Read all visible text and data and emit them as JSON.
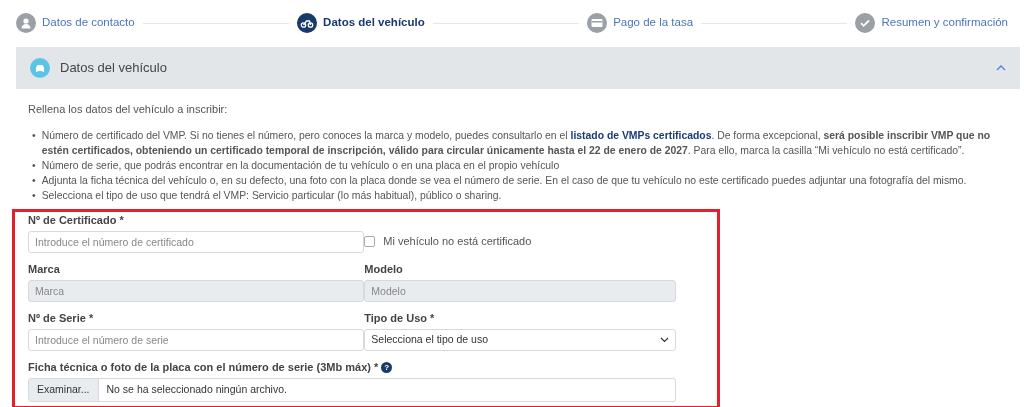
{
  "steps": [
    {
      "label": "Datos de contacto",
      "selected": false
    },
    {
      "label": "Datos del vehículo",
      "selected": true
    },
    {
      "label": "Pago de la tasa",
      "selected": false
    },
    {
      "label": "Resumen y confirmación",
      "selected": false
    }
  ],
  "section": {
    "title": "Datos del vehículo",
    "expanded": true
  },
  "intro": "Rellena los datos del vehículo a inscribir:",
  "bullets": [
    {
      "marker": "•",
      "segments": [
        {
          "kind": "text",
          "text": "Número de certificado del VMP. Si no tienes el número, pero conoces la marca y modelo, puedes consultarlo en el "
        },
        {
          "kind": "link",
          "text": "listado de VMPs certificados"
        },
        {
          "kind": "text",
          "text": ". De forma excepcional, **será posible inscribir VMP que no estén certificados, obteniendo un certificado temporal de inscripción, válido para circular únicamente hasta el 22 de enero de 2027**. Para ello, marca la casilla “Mi vehículo no está certificado”."
        }
      ]
    },
    {
      "marker": "•",
      "segments": [
        {
          "kind": "text",
          "text": "Número de serie, que podrás encontrar en la documentación de tu vehículo o en una placa en el propio vehículo"
        }
      ]
    },
    {
      "marker": "•",
      "segments": [
        {
          "kind": "text",
          "text": "Adjunta la ficha técnica del vehículo o, en su defecto, una foto con la placa donde se vea el número de serie. En el caso de que tu vehículo no este certificado puedes adjuntar una fotografía del mismo."
        }
      ]
    },
    {
      "marker": "•",
      "segments": [
        {
          "kind": "text",
          "text": "Selecciona el tipo de uso que tendrá el VMP: Servicio particular (lo más habitual), público o sharing."
        }
      ]
    }
  ],
  "form": {
    "certificate": {
      "label": "Nº de Certificado *",
      "placeholder": "Introduce el número de certificado"
    },
    "not_certified": {
      "label": "Mi vehículo no está certificado",
      "checked": false
    },
    "brand": {
      "label": "Marca",
      "placeholder": "Marca",
      "disabled": true
    },
    "model": {
      "label": "Modelo",
      "placeholder": "Modelo",
      "disabled": true
    },
    "serial": {
      "label": "Nº de Serie *",
      "placeholder": "Introduce el número de serie"
    },
    "use_type": {
      "label": "Tipo de Uso *",
      "value": "Selecciona el tipo de uso"
    },
    "file": {
      "label": "Ficha técnica o foto de la placa con el número de serie (3Mb máx) *",
      "help": "?",
      "button": "Examinar...",
      "value": "No se ha seleccionado ningún archivo."
    }
  }
}
